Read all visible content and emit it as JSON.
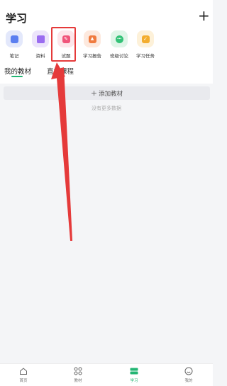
{
  "header": {
    "title": "学习",
    "add_symbol": "+"
  },
  "shortcuts": [
    {
      "label": "笔记",
      "icon": "notebook-icon",
      "bg": "#e3e8fb",
      "fg": "#5b7ff0",
      "glyph": ""
    },
    {
      "label": "资料",
      "icon": "folder-icon",
      "bg": "#ece4fb",
      "fg": "#9a6cf0",
      "glyph": ""
    },
    {
      "label": "试题",
      "icon": "pencil-icon",
      "bg": "#fde6ea",
      "fg": "#f0557a",
      "glyph": "✎"
    },
    {
      "label": "学习报告",
      "icon": "report-icon",
      "bg": "#fde9de",
      "fg": "#f07b3f",
      "glyph": "▲"
    },
    {
      "label": "班级讨论",
      "icon": "chat-icon",
      "bg": "#dff5e8",
      "fg": "#33c277",
      "glyph": "•••"
    },
    {
      "label": "学习任务",
      "icon": "task-icon",
      "bg": "#fdf1d9",
      "fg": "#f3ad2e",
      "glyph": "✓"
    }
  ],
  "tabs": [
    {
      "label": "我的教材",
      "active": true
    },
    {
      "label": "直播课程",
      "active": false
    }
  ],
  "content": {
    "add_label": "添加教材",
    "add_symbol": "+",
    "empty_text": "没有更多数据"
  },
  "annotation": {
    "color": "#e53a3a",
    "target": "试题"
  },
  "bottom_nav": [
    {
      "label": "首页",
      "icon": "home-icon",
      "active": false
    },
    {
      "label": "教材",
      "icon": "grid-icon",
      "active": false
    },
    {
      "label": "学习",
      "icon": "study-icon",
      "active": true
    },
    {
      "label": "我的",
      "icon": "profile-icon",
      "active": false
    }
  ],
  "colors": {
    "accent": "#22b573",
    "annotation": "#e53a3a",
    "background": "#f4f5f7"
  }
}
